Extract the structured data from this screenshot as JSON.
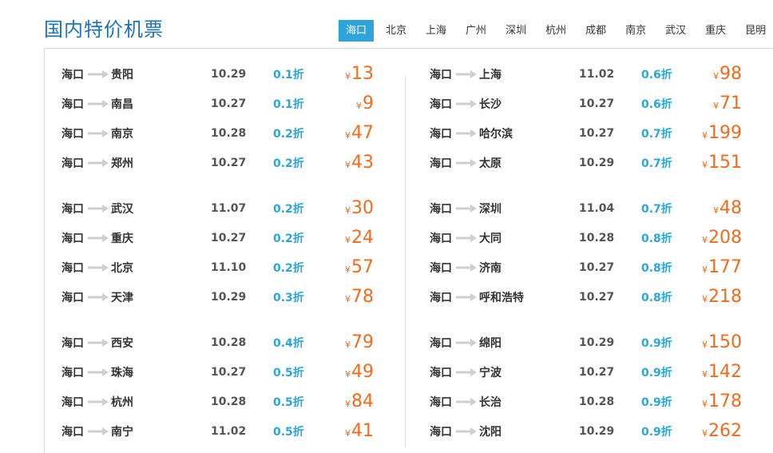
{
  "title": "国内特价机票",
  "tabs": [
    "海口",
    "北京",
    "上海",
    "广州",
    "深圳",
    "杭州",
    "成都",
    "南京",
    "武汉",
    "重庆",
    "昆明"
  ],
  "active_tab": 0,
  "more_label": ">>",
  "currency_symbol": "¥",
  "colors": {
    "accent": "#2da5da",
    "title": "#1a74ba",
    "price": "#f26a1b",
    "discount": "#2ba6d9"
  },
  "left_column": [
    {
      "from": "海口",
      "to": "贵阳",
      "date": "10.29",
      "discount": "0.1折",
      "price": "13"
    },
    {
      "from": "海口",
      "to": "南昌",
      "date": "10.27",
      "discount": "0.1折",
      "price": "9"
    },
    {
      "from": "海口",
      "to": "南京",
      "date": "10.28",
      "discount": "0.2折",
      "price": "47"
    },
    {
      "from": "海口",
      "to": "郑州",
      "date": "10.27",
      "discount": "0.2折",
      "price": "43"
    },
    {
      "from": "海口",
      "to": "武汉",
      "date": "11.07",
      "discount": "0.2折",
      "price": "30"
    },
    {
      "from": "海口",
      "to": "重庆",
      "date": "10.27",
      "discount": "0.2折",
      "price": "24"
    },
    {
      "from": "海口",
      "to": "北京",
      "date": "11.10",
      "discount": "0.2折",
      "price": "57"
    },
    {
      "from": "海口",
      "to": "天津",
      "date": "10.29",
      "discount": "0.3折",
      "price": "78"
    },
    {
      "from": "海口",
      "to": "西安",
      "date": "10.28",
      "discount": "0.4折",
      "price": "79"
    },
    {
      "from": "海口",
      "to": "珠海",
      "date": "10.27",
      "discount": "0.5折",
      "price": "49"
    },
    {
      "from": "海口",
      "to": "杭州",
      "date": "10.28",
      "discount": "0.5折",
      "price": "84"
    },
    {
      "from": "海口",
      "to": "南宁",
      "date": "11.02",
      "discount": "0.5折",
      "price": "41"
    }
  ],
  "right_column": [
    {
      "from": "海口",
      "to": "上海",
      "date": "11.02",
      "discount": "0.6折",
      "price": "98"
    },
    {
      "from": "海口",
      "to": "长沙",
      "date": "10.27",
      "discount": "0.6折",
      "price": "71"
    },
    {
      "from": "海口",
      "to": "哈尔滨",
      "date": "10.27",
      "discount": "0.7折",
      "price": "199"
    },
    {
      "from": "海口",
      "to": "太原",
      "date": "10.29",
      "discount": "0.7折",
      "price": "151"
    },
    {
      "from": "海口",
      "to": "深圳",
      "date": "11.04",
      "discount": "0.7折",
      "price": "48"
    },
    {
      "from": "海口",
      "to": "大同",
      "date": "10.28",
      "discount": "0.8折",
      "price": "208"
    },
    {
      "from": "海口",
      "to": "济南",
      "date": "10.27",
      "discount": "0.8折",
      "price": "177"
    },
    {
      "from": "海口",
      "to": "呼和浩特",
      "date": "10.27",
      "discount": "0.8折",
      "price": "218"
    },
    {
      "from": "海口",
      "to": "绵阳",
      "date": "10.29",
      "discount": "0.9折",
      "price": "150"
    },
    {
      "from": "海口",
      "to": "宁波",
      "date": "10.27",
      "discount": "0.9折",
      "price": "142"
    },
    {
      "from": "海口",
      "to": "长治",
      "date": "10.28",
      "discount": "0.9折",
      "price": "178"
    },
    {
      "from": "海口",
      "to": "沈阳",
      "date": "10.29",
      "discount": "0.9折",
      "price": "262"
    }
  ]
}
